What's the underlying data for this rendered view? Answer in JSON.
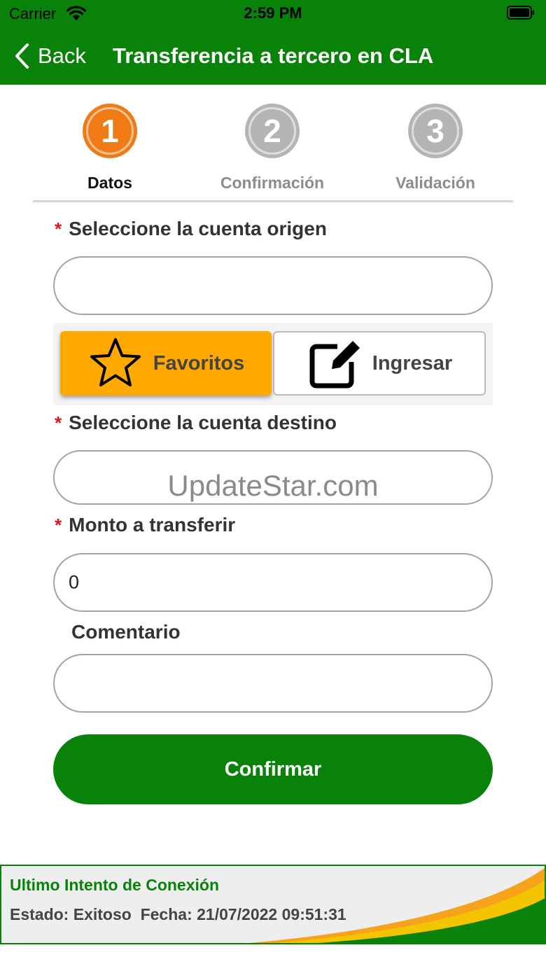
{
  "status_bar": {
    "carrier": "Carrier",
    "time": "2:59 PM"
  },
  "nav": {
    "back_label": "Back",
    "title": "Transferencia a tercero en CLA"
  },
  "steps": [
    {
      "number": "1",
      "label": "Datos",
      "state": "active",
      "color": "#f07a14"
    },
    {
      "number": "2",
      "label": "Confirmación",
      "state": "inactive",
      "color": "#b4b4b4"
    },
    {
      "number": "3",
      "label": "Validación",
      "state": "inactive",
      "color": "#b4b4b4"
    }
  ],
  "form": {
    "required_marker": "*",
    "origin_label": "Seleccione la cuenta origen",
    "origin_value": "",
    "segment": {
      "favorites_label": "Favoritos",
      "enter_label": "Ingresar",
      "selected": "Favoritos"
    },
    "destination_label": "Seleccione la cuenta destino",
    "destination_value": "",
    "amount_label": "Monto a transferir",
    "amount_value": "0",
    "comment_label": "Comentario",
    "comment_value": ""
  },
  "watermark": "UpdateStar.com",
  "confirm_label": "Confirmar",
  "footer": {
    "title": "Ultimo Intento de Conexión",
    "status_line": "Estado: Exitoso  Fecha: 21/07/2022 09:51:31"
  },
  "colors": {
    "brand_green": "#088208",
    "accent_orange": "#f07a14",
    "segment_selected": "#ffa800",
    "required": "#e01515"
  },
  "icons": [
    "wifi-icon",
    "battery-icon",
    "back-chevron-icon",
    "star-icon",
    "edit-icon"
  ]
}
